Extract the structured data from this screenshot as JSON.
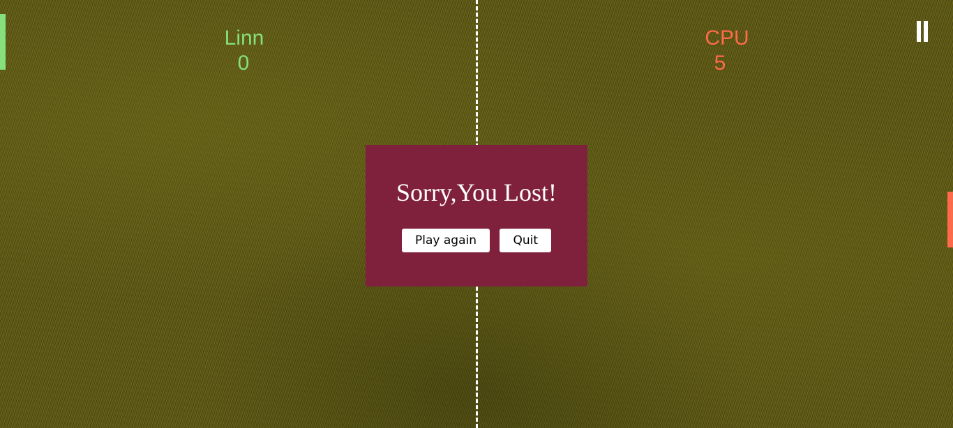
{
  "colors": {
    "player": "#86e07c",
    "cpu": "#ff6a4b",
    "modal_bg": "#7f213d",
    "center_line": "#ffffff"
  },
  "player": {
    "name": "Linn",
    "score": "0"
  },
  "cpu": {
    "name": "CPU",
    "score": "5"
  },
  "pause_icon": "pause-icon",
  "modal": {
    "title": "Sorry,You Lost!",
    "play_again_label": "Play again",
    "quit_label": "Quit"
  }
}
